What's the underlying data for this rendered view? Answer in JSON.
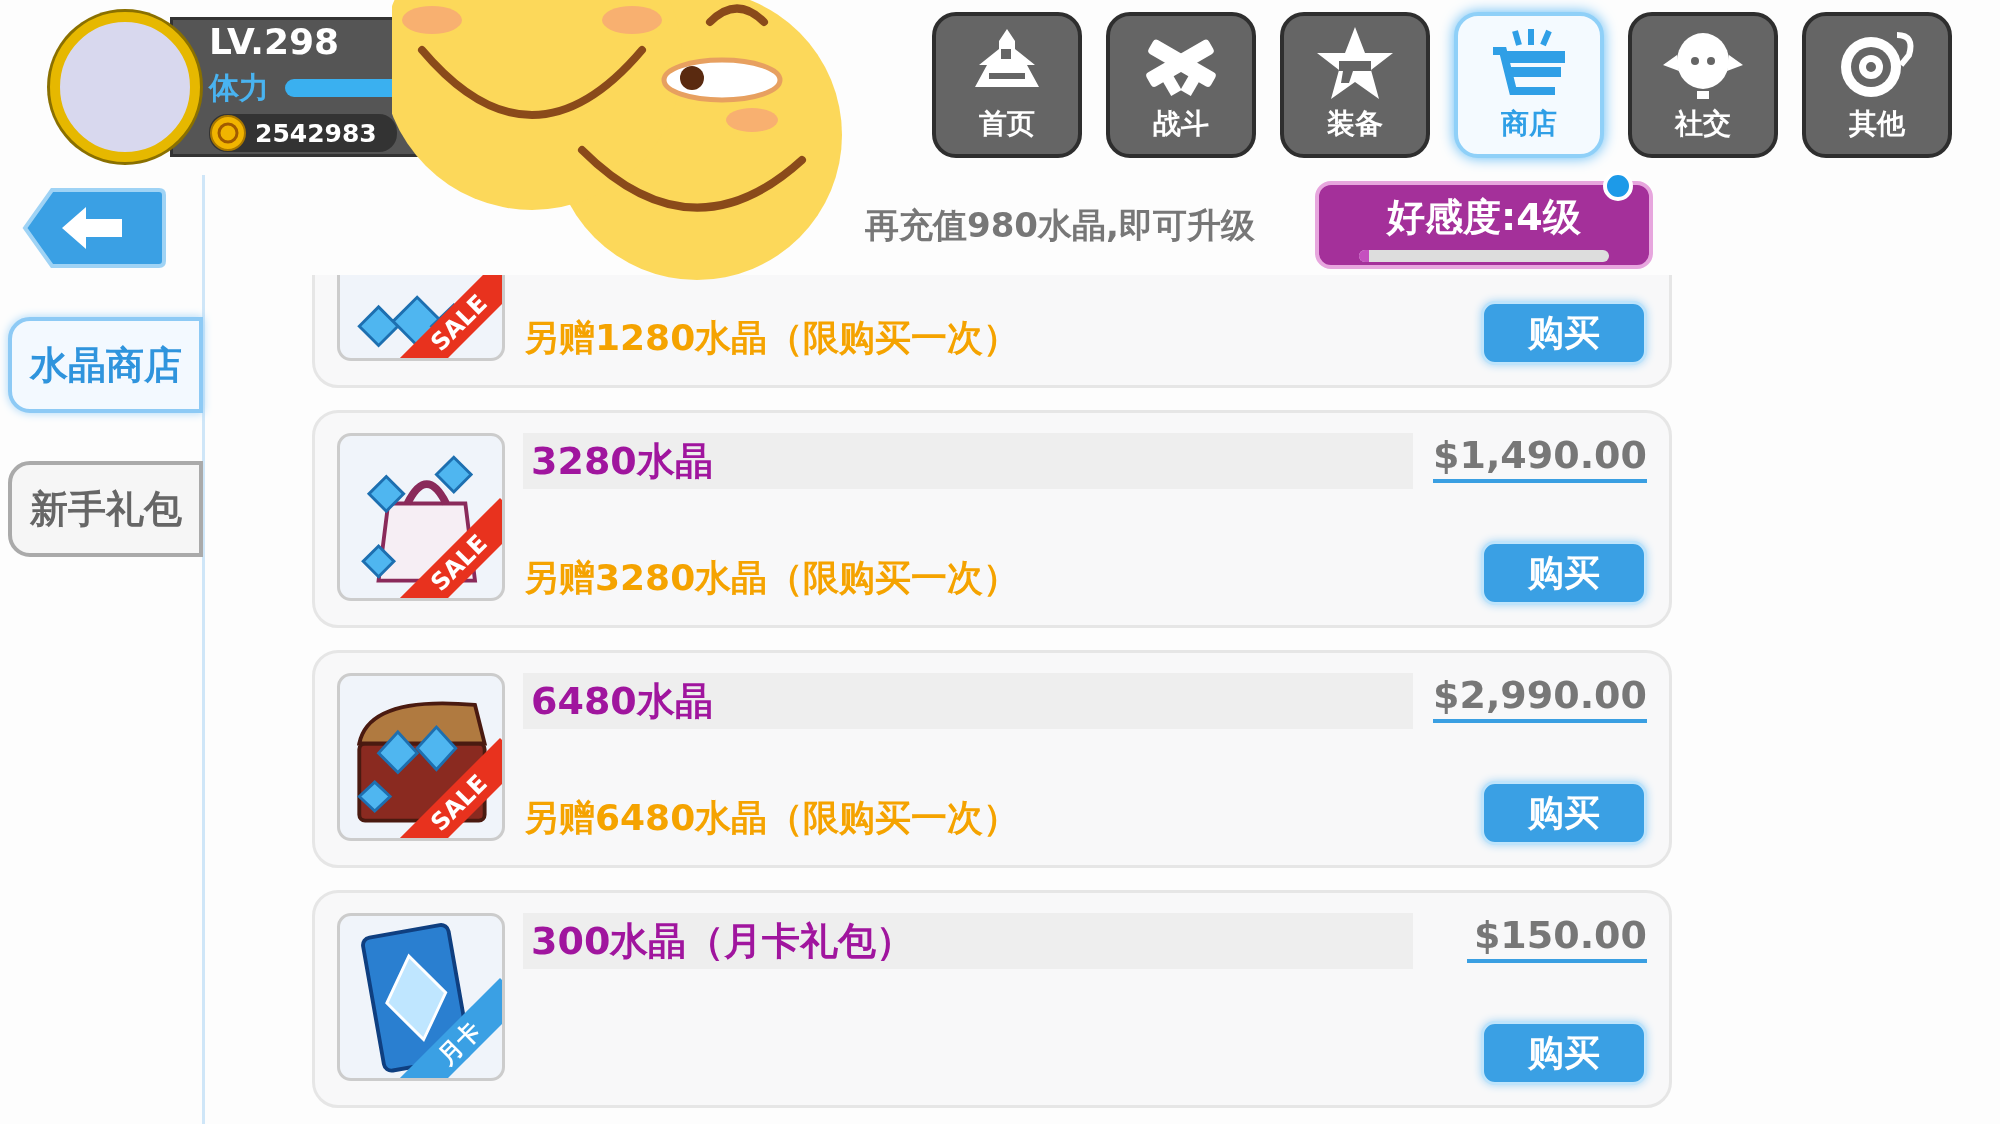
{
  "profile": {
    "level": "LV.298",
    "stamina_label": "体力",
    "coins": "2542983"
  },
  "nav": [
    {
      "label": "首页",
      "kind": "home",
      "selected": false
    },
    {
      "label": "战斗",
      "kind": "battle",
      "selected": false
    },
    {
      "label": "装备",
      "kind": "equip",
      "selected": false
    },
    {
      "label": "商店",
      "kind": "shop",
      "selected": true
    },
    {
      "label": "社交",
      "kind": "social",
      "selected": false
    },
    {
      "label": "其他",
      "kind": "other",
      "selected": false
    }
  ],
  "sidebar": [
    {
      "label": "水晶商店",
      "selected": true
    },
    {
      "label": "新手礼包",
      "selected": false
    }
  ],
  "notice": "再充值**980水晶**,即可升级",
  "favor": {
    "label": "好感度:4级",
    "level": 0.04,
    "dot": true
  },
  "items": [
    {
      "kind": "gems",
      "ribbon": {
        "text": "SALE",
        "color": "#e8321e"
      },
      "bonus": "另赠1280水晶（限购买一次）",
      "button": "购买"
    },
    {
      "kind": "bag",
      "title": "3280水晶",
      "price": "$1,490.00",
      "ribbon": {
        "text": "SALE",
        "color": "#e8321e"
      },
      "bonus": "另赠3280水晶（限购买一次）",
      "button": "购买"
    },
    {
      "kind": "chest",
      "title": "6480水晶",
      "price": "$2,990.00",
      "ribbon": {
        "text": "SALE",
        "color": "#e8321e"
      },
      "bonus": "另赠6480水晶（限购买一次）",
      "button": "购买"
    },
    {
      "kind": "card",
      "title": "300水晶（月卡礼包）",
      "price": "$150.00",
      "ribbon": {
        "text": "月卡",
        "color": "#3aa0e4"
      },
      "button": "购买"
    }
  ]
}
